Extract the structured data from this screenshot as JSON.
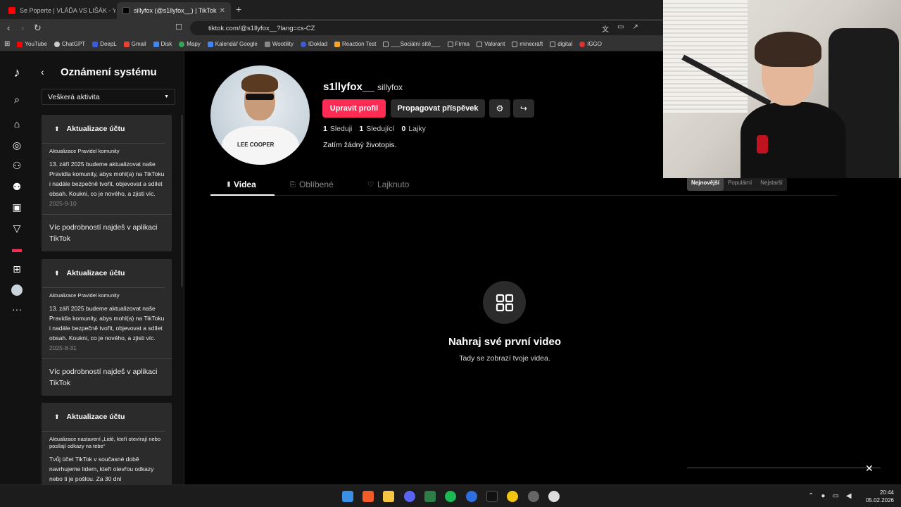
{
  "browser": {
    "tabs": [
      {
        "title": "Se Poperte | VLÁĎA VS LIŠÁK - YouT..."
      },
      {
        "title": "sillyfox (@s1llyfox__) | TikTok"
      }
    ],
    "new_tab": "+",
    "url": "tiktok.com/@s1llyfox__?lang=cs-CZ",
    "bookmarks": [
      {
        "label": "YouTube",
        "color": "#ff0000"
      },
      {
        "label": "ChatGPT",
        "color": "#cccccc"
      },
      {
        "label": "DeepL",
        "color": "#0f2b46"
      },
      {
        "label": "Gmail",
        "color": "#ea4335"
      },
      {
        "label": "Disk",
        "color": "#4285f4"
      },
      {
        "label": "Mapy",
        "color": "#34a853"
      },
      {
        "label": "Kalendář Google",
        "color": "#4285f4"
      },
      {
        "label": "Wootility",
        "color": "#888888"
      },
      {
        "label": "IDoklad",
        "color": "#3b5bdb"
      },
      {
        "label": "Reaction Test",
        "color": "#f5a623"
      },
      {
        "label": "___Sociální sítě___",
        "color": "#bbbbbb"
      },
      {
        "label": "Firma",
        "color": "#bbbbbb"
      },
      {
        "label": "Valorant",
        "color": "#bbbbbb"
      },
      {
        "label": "minecraft",
        "color": "#bbbbbb"
      },
      {
        "label": "digital",
        "color": "#bbbbbb"
      },
      {
        "label": "IGGO",
        "color": "#e03131"
      }
    ]
  },
  "panel": {
    "title": "Oznámení systému",
    "filter": "Veškerá aktivita",
    "cards": [
      {
        "heading": "Aktualizace účtu",
        "sub": "Aktualizace Pravidel komunity",
        "body": "13. září 2025 budeme aktualizovat naše Pravidla komunity, abys mohl(a) na TikToku i nadále bezpečně tvořit, objevovat a sdílet obsah. Koukni, co je nového, a zjisti víc.",
        "date": "2025-9-10",
        "footer": "Víc podrobností najdeš v aplikaci TikTok"
      },
      {
        "heading": "Aktualizace účtu",
        "sub": "Aktualizace Pravidel komunity",
        "body": "13. září 2025 budeme aktualizovat naše Pravidla komunity, abys mohl(a) na TikToku i nadále bezpečně tvořit, objevovat a sdílet obsah. Koukni, co je nového, a zjisti víc.",
        "date": "2025-8-31",
        "footer": "Víc podrobností najdeš v aplikaci TikTok"
      },
      {
        "heading": "Aktualizace účtu",
        "sub": "Aktualizace nastavení „Lidé, kteří otevírají nebo posílají odkazy na tebe“",
        "body": "Tvůj účet TikTok v současné době navrhujeme lidem, kteří otevřou odkazy nebo ti je pošlou. Za 30 dní",
        "date": "",
        "footer": ""
      }
    ]
  },
  "profile": {
    "username": "s1llyfox__",
    "nickname": "sillyfox",
    "edit_label": "Upravit profil",
    "promote_label": "Propagovat příspěvek",
    "following_count": "1",
    "following_label": "Sleduji",
    "followers_count": "1",
    "followers_label": "Sledující",
    "likes_count": "0",
    "likes_label": "Lajky",
    "bio": "Zatím žádný životopis.",
    "avatar_shirt_text": "LEE COOPER"
  },
  "content_tabs": {
    "videos": "Videa",
    "favorites": "Oblíbené",
    "liked": "Lajknuto"
  },
  "sort": {
    "newest": "Nejnovější",
    "popular": "Populární",
    "oldest": "Nejstarší"
  },
  "empty": {
    "title": "Nahraj své první video",
    "subtitle": "Tady se zobrazí tvoje videa."
  },
  "taskbar": {
    "time": "20:44",
    "date": "05.02.2026"
  }
}
